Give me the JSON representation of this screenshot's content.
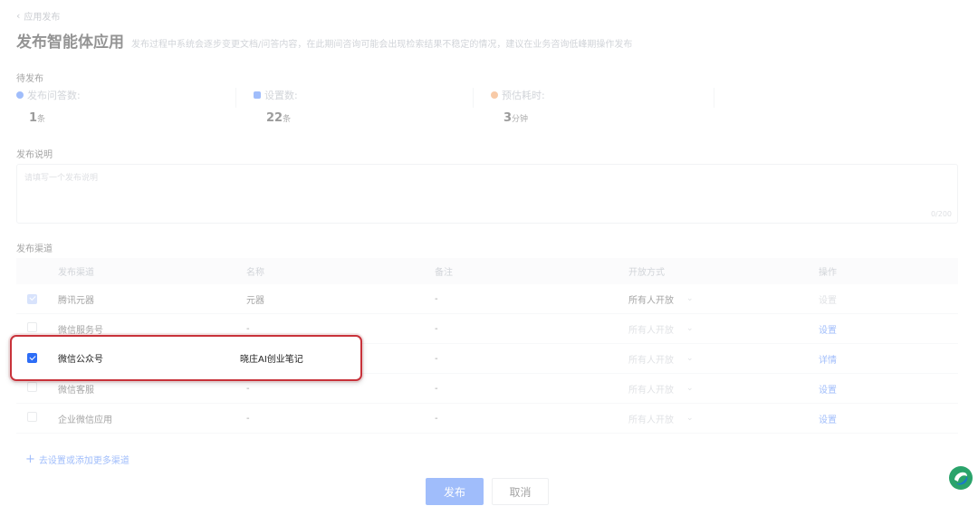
{
  "nav": {
    "back_label": "应用发布"
  },
  "header": {
    "title": "发布智能体应用",
    "subtitle": "发布过程中系统会逐步变更文档/问答内容，在此期间咨询可能会出现检索结果不稳定的情况，建议在业务咨询低峰期操作发布"
  },
  "pending": {
    "label": "待发布",
    "stats": [
      {
        "label": "发布问答数:",
        "value": "1",
        "unit": "条",
        "color": "#2d6df6"
      },
      {
        "label": "设置数:",
        "value": "22",
        "unit": "条",
        "color": "#2d6df6"
      },
      {
        "label": "预估耗时:",
        "value": "3",
        "unit": "分钟",
        "color": "#f08a3c"
      }
    ]
  },
  "description": {
    "label": "发布说明",
    "placeholder": "请填写一个发布说明",
    "counter": "0/200"
  },
  "channels": {
    "label": "发布渠道",
    "columns": [
      "发布渠道",
      "名称",
      "备注",
      "开放方式",
      "操作"
    ],
    "rows": [
      {
        "channel": "腾讯元器",
        "name": "元器",
        "note": "-",
        "access": "所有人开放",
        "action": "设置",
        "checked": true
      },
      {
        "channel": "微信服务号",
        "name": "-",
        "note": "-",
        "access": "所有人开放",
        "action": "设置",
        "checked": false
      },
      {
        "channel": "微信公众号",
        "name": "晓庄AI创业笔记",
        "note": "-",
        "access": "所有人开放",
        "action": "详情",
        "checked": true
      },
      {
        "channel": "微信客服",
        "name": "-",
        "note": "-",
        "access": "所有人开放",
        "action": "设置",
        "checked": false
      },
      {
        "channel": "企业微信应用",
        "name": "-",
        "note": "-",
        "access": "所有人开放",
        "action": "设置",
        "checked": false
      }
    ],
    "add_label": "去设置或添加更多渠道"
  },
  "footer": {
    "publish_label": "发布",
    "cancel_label": "取消"
  },
  "accent_color": "#2d6df6",
  "highlight_color": "#c8323a"
}
